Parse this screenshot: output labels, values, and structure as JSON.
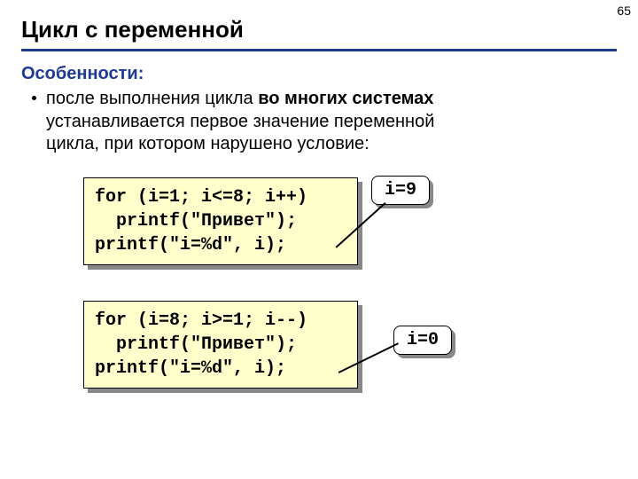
{
  "page_number": "65",
  "title": "Цикл с переменной",
  "subtitle": "Особенности:",
  "bullet": {
    "line1_a": "после выполнения цикла ",
    "line1_b": "во многих системах",
    "line2": "устанавливается первое значение переменной",
    "line3": "цикла, при котором нарушено условие:"
  },
  "code1": "for (i=1; i<=8; i++)\n  printf(\"Привет\");\nprintf(\"i=%d\", i);",
  "result1": "i=9",
  "code2": "for (i=8; i>=1; i--)\n  printf(\"Привет\");\nprintf(\"i=%d\", i);",
  "result2": "i=0"
}
